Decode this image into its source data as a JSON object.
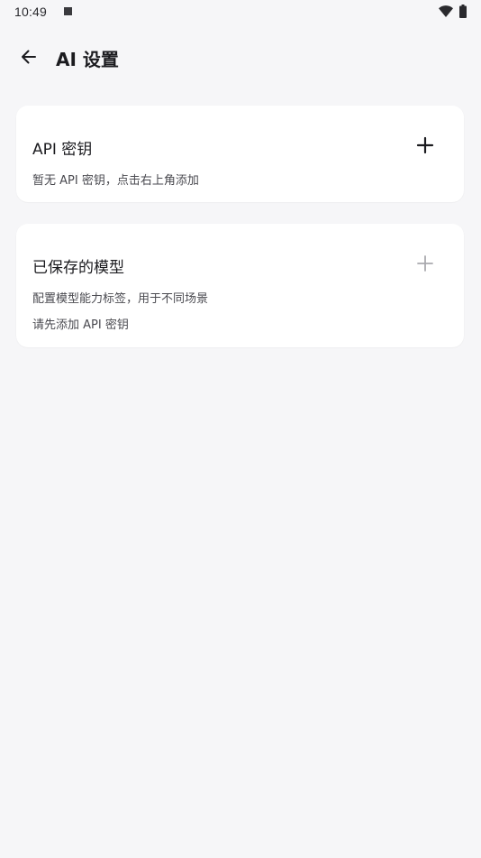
{
  "status_bar": {
    "time": "10:49"
  },
  "header": {
    "title": "AI 设置"
  },
  "api_keys_card": {
    "title": "API 密钥",
    "empty_text": "暂无 API 密钥，点击右上角添加",
    "add_icon": "plus-icon",
    "add_enabled": true
  },
  "saved_models_card": {
    "title": "已保存的模型",
    "description": "配置模型能力标签，用于不同场景",
    "hint": "请先添加 API 密钥",
    "add_icon": "plus-icon",
    "add_enabled": false
  },
  "colors": {
    "background": "#f6f6f8",
    "card": "#ffffff",
    "text_primary": "#1b1b1f",
    "text_secondary": "#4a4a50",
    "icon_disabled": "#a9a9ae"
  }
}
